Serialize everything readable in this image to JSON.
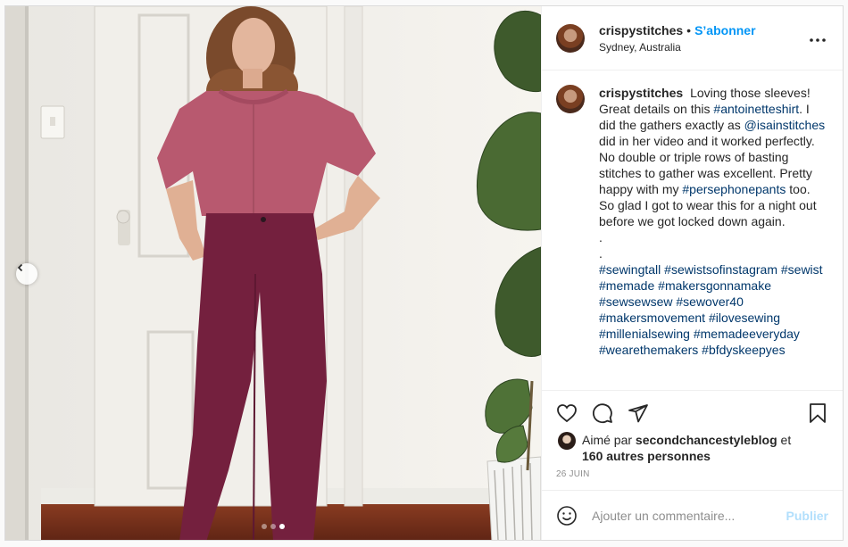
{
  "post": {
    "username": "crispystitches",
    "separator": "•",
    "follow_label": "S’abonner",
    "location": "Sydney, Australia",
    "more_icon": "ellipsis-icon"
  },
  "caption": {
    "username": "crispystitches",
    "parts": [
      {
        "text": "Loving those sleeves! Great details on this ",
        "tag": false
      },
      {
        "text": "#antoinetteshirt",
        "tag": true
      },
      {
        "text": ". I did the gathers exactly as ",
        "tag": false
      },
      {
        "text": "@isainstitches",
        "tag": true
      },
      {
        "text": " did in her video and it worked perfectly. No double or triple rows of basting stitches to gather was excellent. Pretty happy with my ",
        "tag": false
      },
      {
        "text": "#persephonepants",
        "tag": true
      },
      {
        "text": " too. So glad I got to wear this for a night out before we got locked down again.",
        "tag": false
      },
      {
        "text": "\n.\n.\n",
        "tag": false
      },
      {
        "text": "#sewingtall",
        "tag": true
      },
      {
        "text": " ",
        "tag": false
      },
      {
        "text": "#sewistsofinstagram",
        "tag": true
      },
      {
        "text": " ",
        "tag": false
      },
      {
        "text": "#sewist",
        "tag": true
      },
      {
        "text": " ",
        "tag": false
      },
      {
        "text": "#memade",
        "tag": true
      },
      {
        "text": " ",
        "tag": false
      },
      {
        "text": "#makersgonnamake",
        "tag": true
      },
      {
        "text": " ",
        "tag": false
      },
      {
        "text": "#sewsewsew",
        "tag": true
      },
      {
        "text": " ",
        "tag": false
      },
      {
        "text": "#sewover40",
        "tag": true
      },
      {
        "text": " ",
        "tag": false
      },
      {
        "text": "#makersmovement",
        "tag": true
      },
      {
        "text": " ",
        "tag": false
      },
      {
        "text": "#ilovesewing",
        "tag": true
      },
      {
        "text": " ",
        "tag": false
      },
      {
        "text": "#millenialsewing",
        "tag": true
      },
      {
        "text": " ",
        "tag": false
      },
      {
        "text": "#memadeeveryday",
        "tag": true
      },
      {
        "text": " ",
        "tag": false
      },
      {
        "text": "#wearethemakers",
        "tag": true
      },
      {
        "text": " ",
        "tag": false
      },
      {
        "text": "#bfdyskeepyes",
        "tag": true
      }
    ]
  },
  "likes": {
    "prefix": "Aimé par ",
    "user": "secondchancestyleblog",
    "conjunction": " et",
    "others": "160 autres personnes"
  },
  "date": "26 JUIN",
  "comment_box": {
    "placeholder": "Ajouter un commentaire...",
    "publish_label": "Publier"
  },
  "carousel": {
    "total": 3,
    "active": 3
  },
  "colors": {
    "link": "#0095f6",
    "hashtag": "#00376b",
    "text": "#262626",
    "muted": "#8e8e8e"
  }
}
